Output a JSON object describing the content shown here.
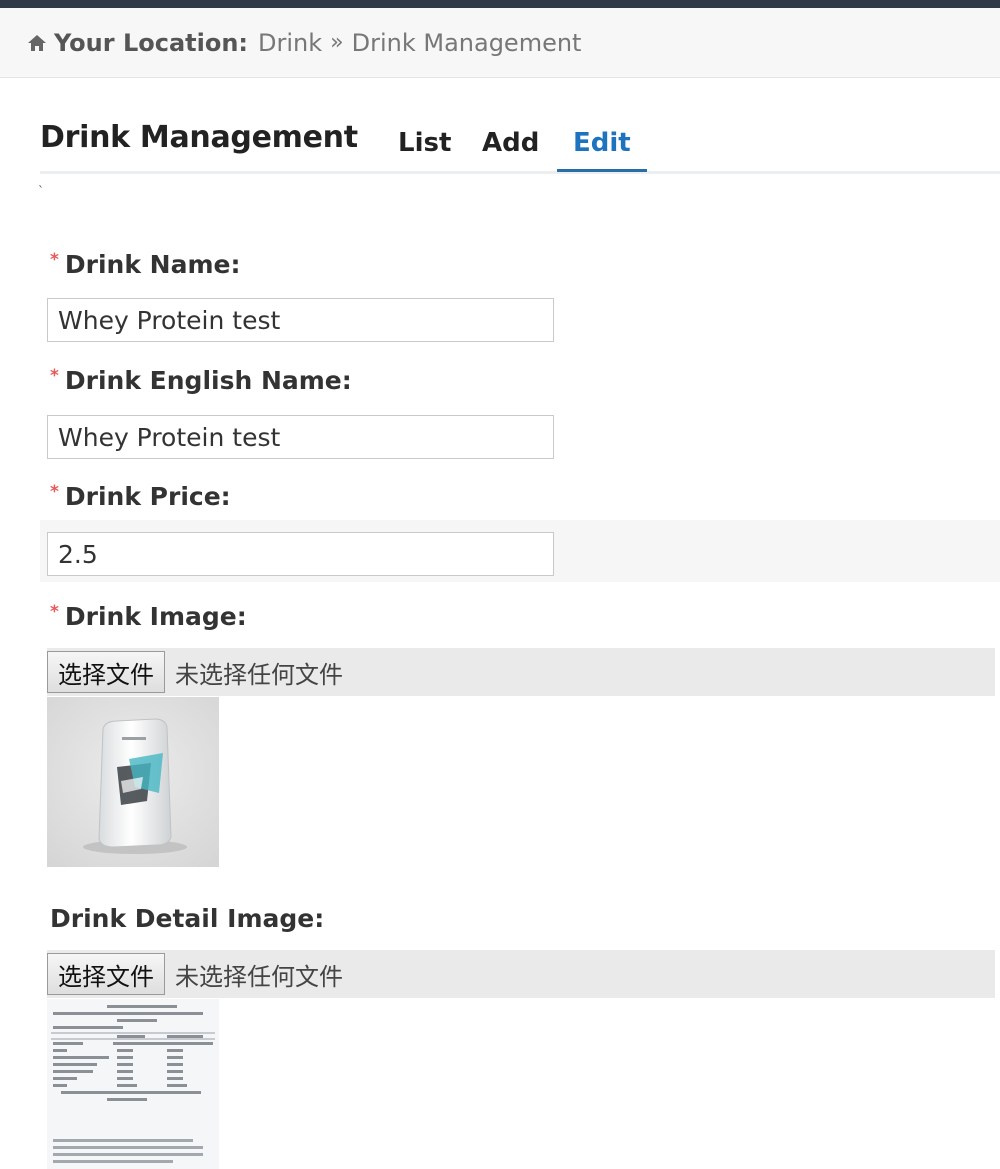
{
  "breadcrumb": {
    "label": "Your Location:",
    "items": [
      "Drink",
      "Drink Management"
    ],
    "separator": "»"
  },
  "header": {
    "title": "Drink Management",
    "tabs": [
      "List",
      "Add",
      "Edit"
    ],
    "active_tab": "Edit"
  },
  "form": {
    "name_label": "Drink Name:",
    "name_value": "Whey Protein test",
    "english_name_label": "Drink English Name:",
    "english_name_value": "Whey Protein test",
    "price_label": "Drink Price:",
    "price_value": "2.5",
    "image_label": "Drink Image:",
    "detail_image_label": "Drink Detail Image:",
    "file_button": "选择文件",
    "no_file_text": "未选择任何文件",
    "required_mark": "*"
  },
  "colors": {
    "active_tab": "#1e73be",
    "required": "#e85a5a"
  }
}
